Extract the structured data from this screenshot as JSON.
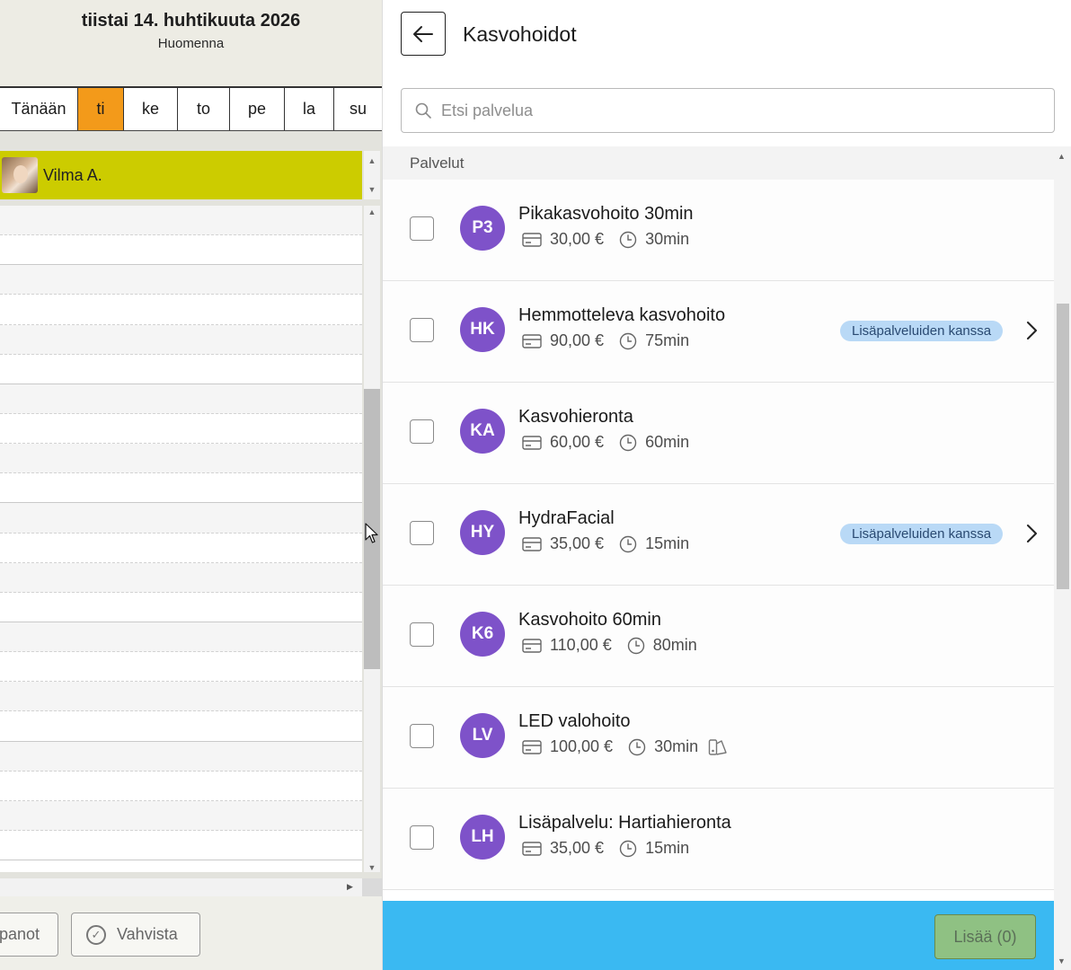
{
  "calendar": {
    "date_title": "tiistai 14. huhtikuuta 2026",
    "date_subtitle": "Huomenna",
    "day_tabs": [
      {
        "label": "Tänään",
        "active": false
      },
      {
        "label": "ti",
        "active": true
      },
      {
        "label": "ke",
        "active": false
      },
      {
        "label": "to",
        "active": false
      },
      {
        "label": "pe",
        "active": false
      },
      {
        "label": "la",
        "active": false
      },
      {
        "label": "su",
        "active": false
      }
    ],
    "staff_name": "Vilma A."
  },
  "left_footer": {
    "saved_label": "panot",
    "confirm_label": "Vahvista"
  },
  "panel": {
    "title": "Kasvohoidot",
    "search_placeholder": "Etsi palvelua",
    "section_label": "Palvelut",
    "services": [
      {
        "initials": "P3",
        "name": "Pikakasvohoito 30min",
        "price": "30,00 €",
        "duration": "30min",
        "badge": "",
        "has_chevron": false,
        "extra_icon": false
      },
      {
        "initials": "HK",
        "name": "Hemmotteleva kasvohoito",
        "price": "90,00 €",
        "duration": "75min",
        "badge": "Lisäpalveluiden kanssa",
        "has_chevron": true,
        "extra_icon": false
      },
      {
        "initials": "KA",
        "name": "Kasvohieronta",
        "price": "60,00 €",
        "duration": "60min",
        "badge": "",
        "has_chevron": false,
        "extra_icon": false
      },
      {
        "initials": "HY",
        "name": "HydraFacial",
        "price": "35,00 €",
        "duration": "15min",
        "badge": "Lisäpalveluiden kanssa",
        "has_chevron": true,
        "extra_icon": false
      },
      {
        "initials": "K6",
        "name": "Kasvohoito 60min",
        "price": "110,00 €",
        "duration": "80min",
        "badge": "",
        "has_chevron": false,
        "extra_icon": false
      },
      {
        "initials": "LV",
        "name": "LED valohoito",
        "price": "100,00 €",
        "duration": "30min",
        "badge": "",
        "has_chevron": false,
        "extra_icon": true
      },
      {
        "initials": "LH",
        "name": "Lisäpalvelu: Hartiahieronta",
        "price": "35,00 €",
        "duration": "15min",
        "badge": "",
        "has_chevron": false,
        "extra_icon": false
      }
    ],
    "add_button_label": "Lisää (0)"
  },
  "colors": {
    "active_day": "#f39a1a",
    "staff_row": "#cccc00",
    "avatar": "#7e52c9",
    "badge_bg": "#b9d9f6",
    "bottom_bar": "#3ab9f2",
    "add_button": "#8fc183"
  },
  "icons": {
    "back": "arrow-left-icon",
    "search": "search-icon",
    "price": "card-icon",
    "duration": "clock-icon",
    "extra": "resource-icon",
    "chevron": "chevron-right-icon",
    "confirm": "check-circle-icon"
  }
}
